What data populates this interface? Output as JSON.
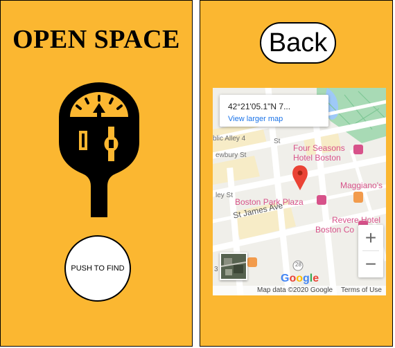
{
  "app": {
    "title": "OPEN SPACE"
  },
  "left_panel": {
    "push_button_label": "PUSH TO FIND"
  },
  "right_panel": {
    "back_label": "Back"
  },
  "map": {
    "info_card": {
      "coords": "42°21'05.1\"N 7...",
      "link": "View larger map"
    },
    "labels": {
      "four_seasons_1": "Four Seasons",
      "four_seasons_2": "Hotel Boston",
      "maggianos": "Maggiano's",
      "boston_park_plaza": "Boston Park Plaza",
      "revere_1": "Revere Hotel",
      "revere_2": "Boston Co",
      "st_james": "St James Ave",
      "newbury": "ewbury St",
      "public_alley": "blic Alley 4",
      "st_fragment": "St",
      "ley_st": "ley St",
      "route": "28",
      "bottom_left": "3"
    },
    "zoom": {
      "in": "+",
      "out": "−"
    },
    "google": [
      "G",
      "o",
      "o",
      "g",
      "l",
      "e"
    ],
    "attribution": "Map data ©2020 Google",
    "terms": "Terms of Use"
  },
  "colors": {
    "panel_bg": "#fbb731",
    "park_green": "#a8dab5",
    "water": "#9ec9f7",
    "pin_red": "#ea4335",
    "poi_pink": "#d7528a",
    "link_blue": "#1a73e8",
    "google": [
      "#4285f4",
      "#ea4335",
      "#fbbc05",
      "#4285f4",
      "#34a853",
      "#ea4335"
    ]
  }
}
